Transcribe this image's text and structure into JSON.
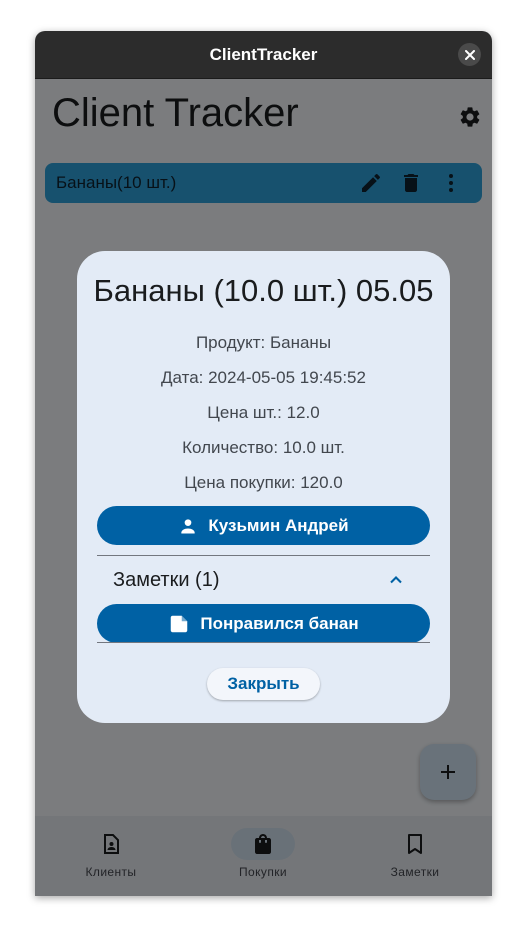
{
  "window": {
    "title": "ClientTracker"
  },
  "app": {
    "title": "Client Tracker"
  },
  "list": {
    "items": [
      {
        "label": "Бананы(10 шт.)"
      }
    ]
  },
  "dialog": {
    "title": "Бананы (10.0 шт.) 05.05",
    "product": "Продукт: Бананы",
    "date": "Дата: 2024-05-05 19:45:52",
    "unit_price": "Цена шт.: 12.0",
    "quantity": "Количество: 10.0 шт.",
    "purchase_price": "Цена покупки: 120.0",
    "client_button": "Кузьмин Андрей",
    "notes_header": "Заметки (1)",
    "note_button": "Понравился банан",
    "close_button": "Закрыть"
  },
  "bottom_nav": {
    "items": [
      {
        "label": "Клиенты",
        "icon": "contact-page-icon",
        "active": false
      },
      {
        "label": "Покупки",
        "icon": "shopping-bag-icon",
        "active": true
      },
      {
        "label": "Заметки",
        "icon": "bookmark-icon",
        "active": false
      }
    ]
  },
  "colors": {
    "primary": "#0061a4",
    "list_item": "#2fa3dc",
    "dialog_bg": "#e3ebf6",
    "titlebar": "#2c2c2c"
  }
}
